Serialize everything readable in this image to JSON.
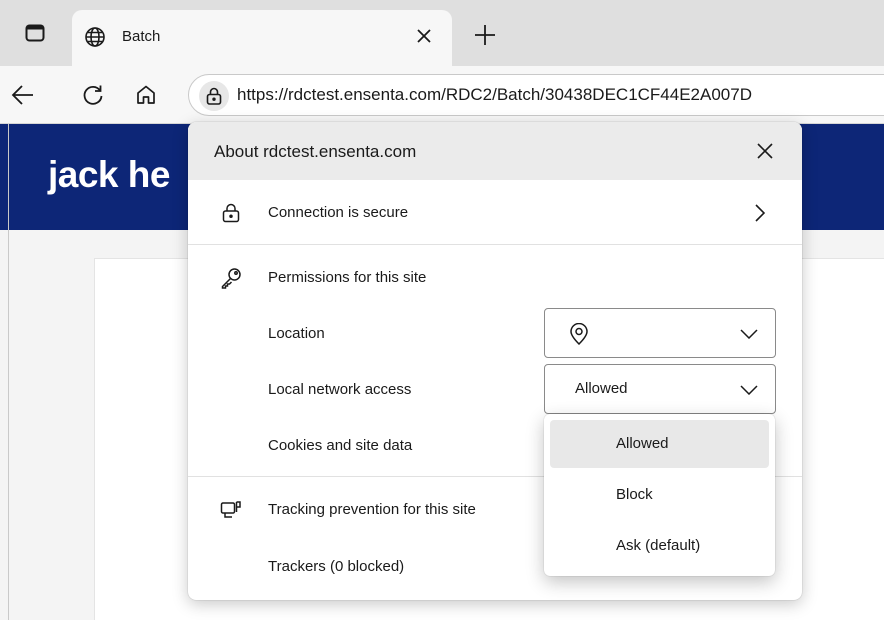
{
  "browser": {
    "tab": {
      "title": "Batch"
    },
    "address_bar": {
      "url": "https://rdctest.ensenta.com/RDC2/Batch/30438DEC1CF44E2A007D"
    }
  },
  "page": {
    "brand_text": "jack he",
    "header_color": "#0d2677"
  },
  "site_info_popup": {
    "title": "About rdctest.ensenta.com",
    "connection": {
      "label": "Connection is secure"
    },
    "permissions": {
      "heading": "Permissions for this site",
      "items": [
        {
          "label": "Location",
          "value": ""
        },
        {
          "label": "Local network access",
          "value": "Allowed"
        },
        {
          "label": "Cookies and site data"
        }
      ]
    },
    "tracking": {
      "heading": "Tracking prevention for this site",
      "trackers_label": "Trackers (0 blocked)"
    }
  },
  "dropdown": {
    "options": [
      "Allowed",
      "Block",
      "Ask (default)"
    ],
    "highlighted": "Allowed"
  },
  "icons": {
    "tab_actions": "tab-actions-icon",
    "favicon": "globe-icon",
    "tab_close": "close-icon",
    "new_tab": "plus-icon",
    "back": "back-arrow-icon",
    "refresh": "refresh-icon",
    "home": "home-icon",
    "lock": "lock-icon",
    "key": "key-icon",
    "location": "location-pin-icon",
    "tracking": "tracking-prevention-icon"
  }
}
